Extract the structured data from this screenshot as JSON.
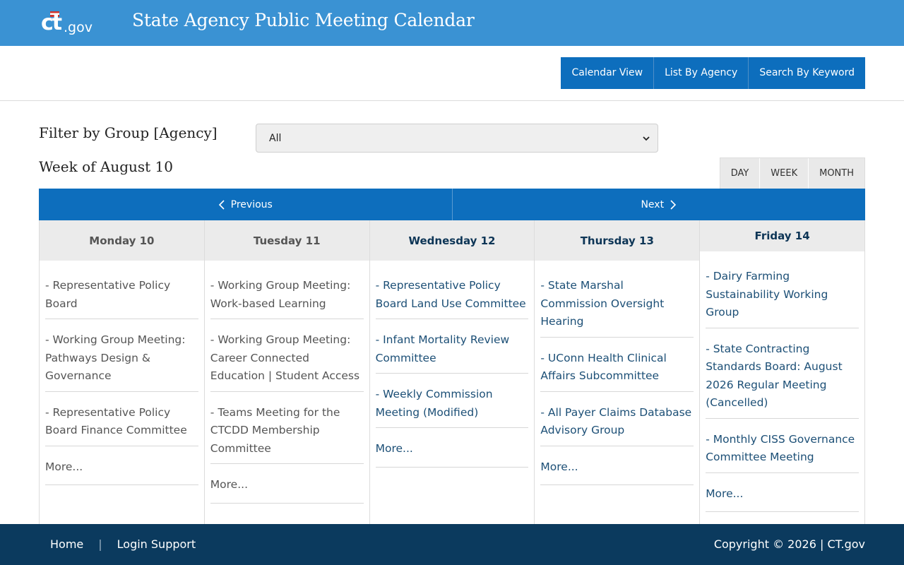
{
  "header": {
    "logo_text": "ct.gov",
    "title": "State Agency Public Meeting Calendar"
  },
  "nav": {
    "items": [
      "Calendar View",
      "List By Agency",
      "Search By Keyword"
    ]
  },
  "filter": {
    "label": "Filter by Group [Agency]",
    "selected": "All"
  },
  "week": {
    "title": "Week of August 10"
  },
  "view_buttons": [
    "DAY",
    "WEEK",
    "MONTH"
  ],
  "pager": {
    "previous": "Previous",
    "next": "Next"
  },
  "days": [
    {
      "heading": "Monday 10",
      "state": "past",
      "events": [
        "- Representative Policy Board",
        "- Working Group Meeting: Pathways Design & Governance",
        "- Representative Policy Board Finance Committee"
      ],
      "more": "More..."
    },
    {
      "heading": "Tuesday 11",
      "state": "past",
      "events": [
        "- Working Group Meeting: Work-based Learning",
        "- Working Group Meeting: Career Connected Education | Student Access",
        "- Teams Meeting for the CTCDD Membership Committee"
      ],
      "more": "More..."
    },
    {
      "heading": "Wednesday 12",
      "state": "future",
      "events": [
        "- Representative Policy Board Land Use Committee",
        "- Infant Mortality Review Committee",
        "- Weekly Commission Meeting (Modified)"
      ],
      "more": "More..."
    },
    {
      "heading": "Thursday 13",
      "state": "future",
      "events": [
        "- State Marshal Commission Oversight Hearing",
        "- UConn Health Clinical Affairs Subcommittee",
        "- All Payer Claims Database Advisory Group"
      ],
      "more": "More..."
    },
    {
      "heading": "Friday 14",
      "state": "future",
      "events": [
        "- Dairy Farming Sustainability Working Group",
        "- State Contracting Standards Board: August 2026 Regular Meeting (Cancelled)",
        "- Monthly CISS Governance Committee Meeting"
      ],
      "more": "More..."
    }
  ],
  "footer": {
    "home": "Home",
    "separator": "|",
    "login_support": "Login Support",
    "copyright": "Copyright © 2026 | CT.gov"
  },
  "colors": {
    "header_bg": "#3a92d3",
    "primary_blue": "#0d6ebd",
    "footer_bg": "#0b3a5e"
  },
  "icons": {
    "prev": "chevron-left-icon",
    "next": "chevron-right-icon",
    "select": "chevron-down-icon"
  }
}
